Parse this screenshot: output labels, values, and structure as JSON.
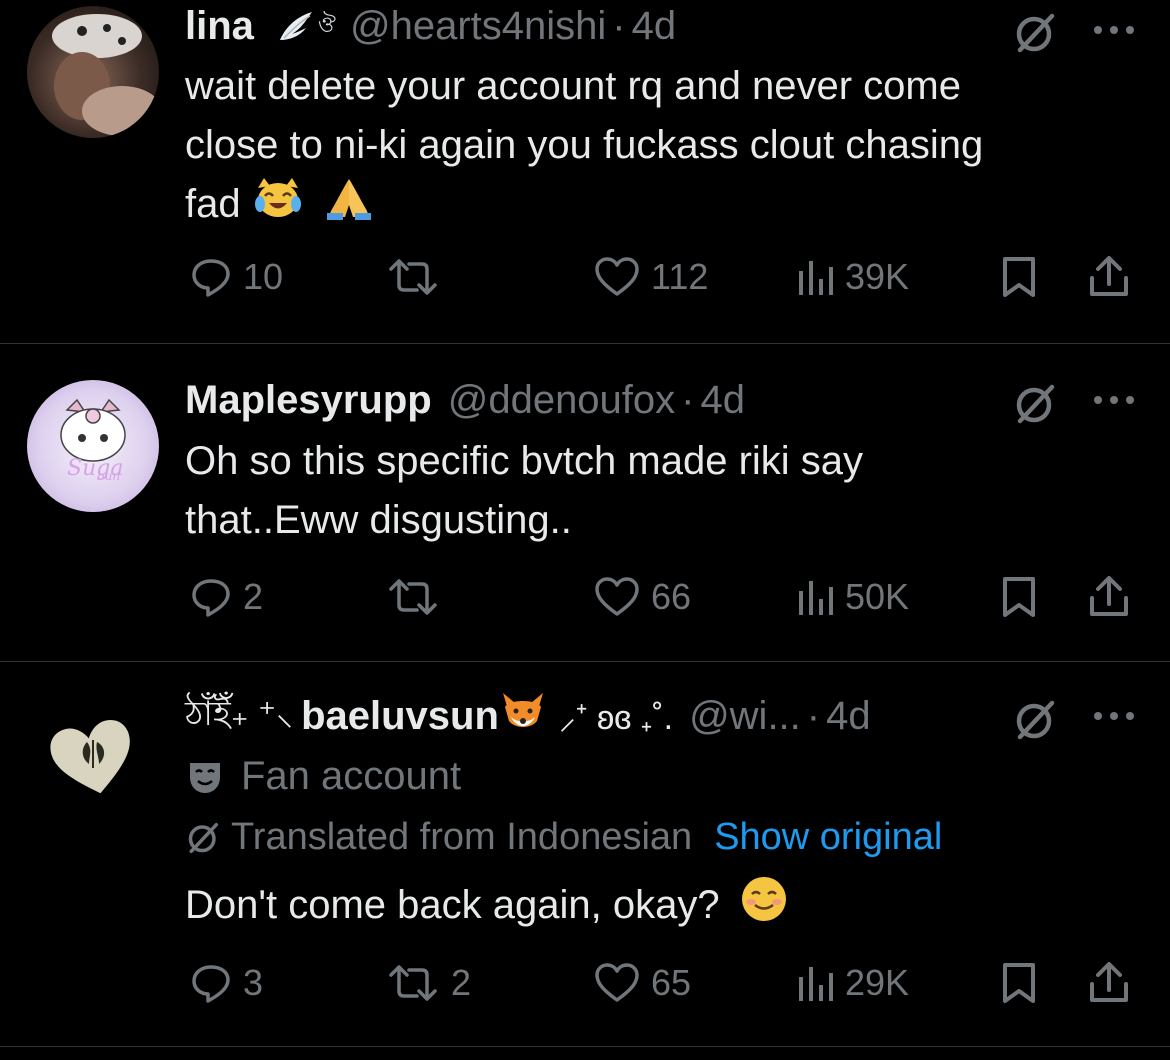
{
  "tweets": [
    {
      "name": "lina",
      "handle": "@hearts4nishi",
      "sep": "·",
      "time": "4d",
      "text_line1": "wait delete your account rq and never come",
      "text_line2": "close to ni-ki again you fuckass clout chasing",
      "text_line3": "fad",
      "replies": "10",
      "reposts": "",
      "likes": "112",
      "views": "39K"
    },
    {
      "name": "Maplesyrupp",
      "handle": "@ddenoufox",
      "sep": "·",
      "time": "4d",
      "text_line1": "Oh so this specific bvtch made riki say",
      "text_line2": "that..Eww disgusting..",
      "replies": "2",
      "reposts": "",
      "likes": "66",
      "views": "50K"
    },
    {
      "name_prefix": "ঠাঁইঁ₊ ⁺⸜",
      "name": "baeluvsun",
      "name_suffix": "⸝⁺ ʚɞ ₊˚.",
      "handle": "@wi...",
      "sep": "·",
      "time": "4d",
      "badge_label": "Fan account",
      "translated_label": "Translated from Indonesian",
      "show_original": "Show original",
      "text_line1": "Don't come back again, okay?",
      "replies": "3",
      "reposts": "2",
      "likes": "65",
      "views": "29K"
    }
  ],
  "colors": {
    "background": "#000000",
    "text": "#e7e9ea",
    "muted": "#71767b",
    "link": "#1d9bf0",
    "divider": "#2f3336"
  },
  "icons": [
    "reply-icon",
    "repost-icon",
    "like-icon",
    "views-icon",
    "bookmark-icon",
    "share-icon",
    "grok-icon",
    "more-icon"
  ]
}
